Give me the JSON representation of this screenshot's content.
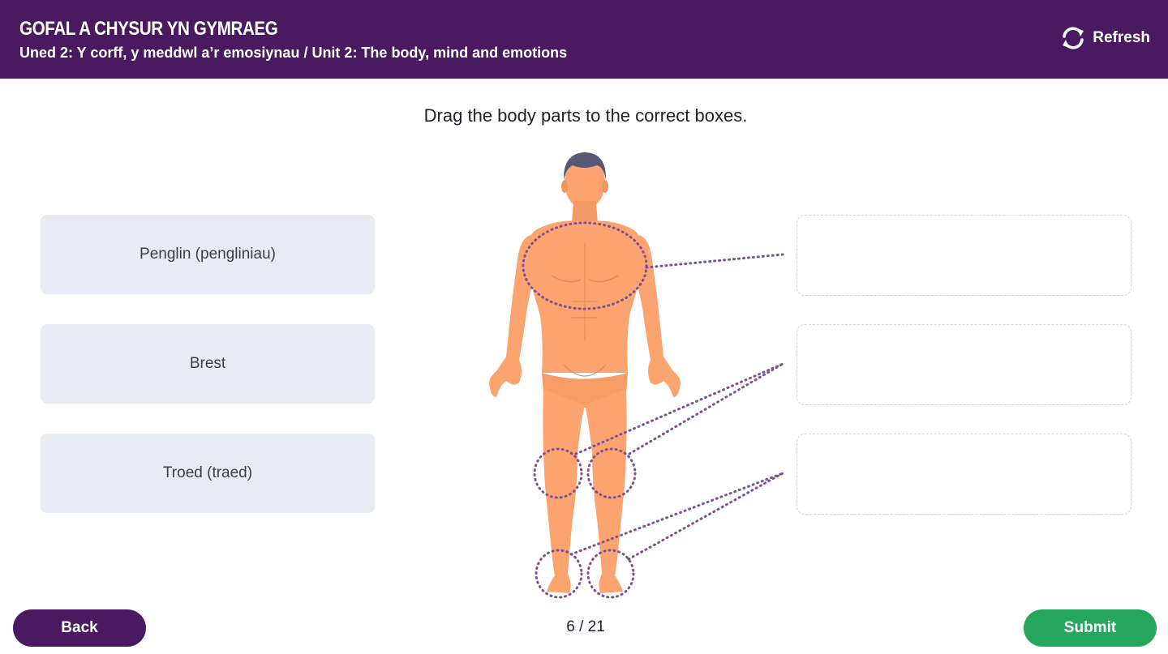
{
  "header": {
    "course_title": "GOFAL A CHYSUR YN GYMRAEG",
    "unit_title": "Uned 2: Y corff, y meddwl a’r emosiynau / Unit 2: The body, mind and emotions",
    "refresh_label": "Refresh",
    "refresh_icon": "refresh-icon"
  },
  "activity": {
    "instruction": "Drag the body parts to the correct boxes.",
    "options": [
      {
        "label": "Penglin (pengliniau)"
      },
      {
        "label": "Brest"
      },
      {
        "label": "Troed (traed)"
      }
    ],
    "dropzones": [
      {
        "target": "chest"
      },
      {
        "target": "knees"
      },
      {
        "target": "feet"
      }
    ],
    "figure": {
      "skin_color": "#fba46f",
      "hair_color": "#575876",
      "marker_color": "#7d4f93"
    }
  },
  "footer": {
    "back_label": "Back",
    "page_counter": "6 / 21",
    "submit_label": "Submit"
  },
  "colors": {
    "brand_purple": "#4a1a60",
    "submit_green": "#25a85e",
    "option_bg": "#e8ebf3"
  }
}
